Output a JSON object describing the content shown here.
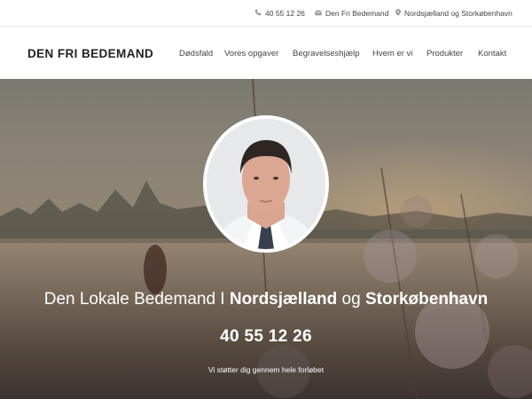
{
  "topbar": {
    "phone": "40 55 12 26",
    "email_label": "Den Fri Bedemand",
    "location": "Nordsjælland og Storkøbenhavn",
    "icons": {
      "phone": "phone-icon",
      "email": "envelope-icon",
      "location": "map-pin-icon"
    }
  },
  "header": {
    "logo": "DEN FRI BEDEMAND",
    "nav": [
      "Dødsfald",
      "Vores opgaver",
      "Begravelseshjælp",
      "Hvem er vi",
      "Produkter",
      "Kontakt"
    ]
  },
  "hero": {
    "headline_pre": "Den Lokale Bedemand I ",
    "headline_b1": "Nordsjælland",
    "headline_mid": " og ",
    "headline_b2": "Storkøbenhavn",
    "phone": "40 55 12 26",
    "tagline": "Vi støtter dig gennem hele forløbet"
  },
  "colors": {
    "accent_text": "#ffffff",
    "nav_text": "#444444",
    "icon_gray": "#999999"
  }
}
